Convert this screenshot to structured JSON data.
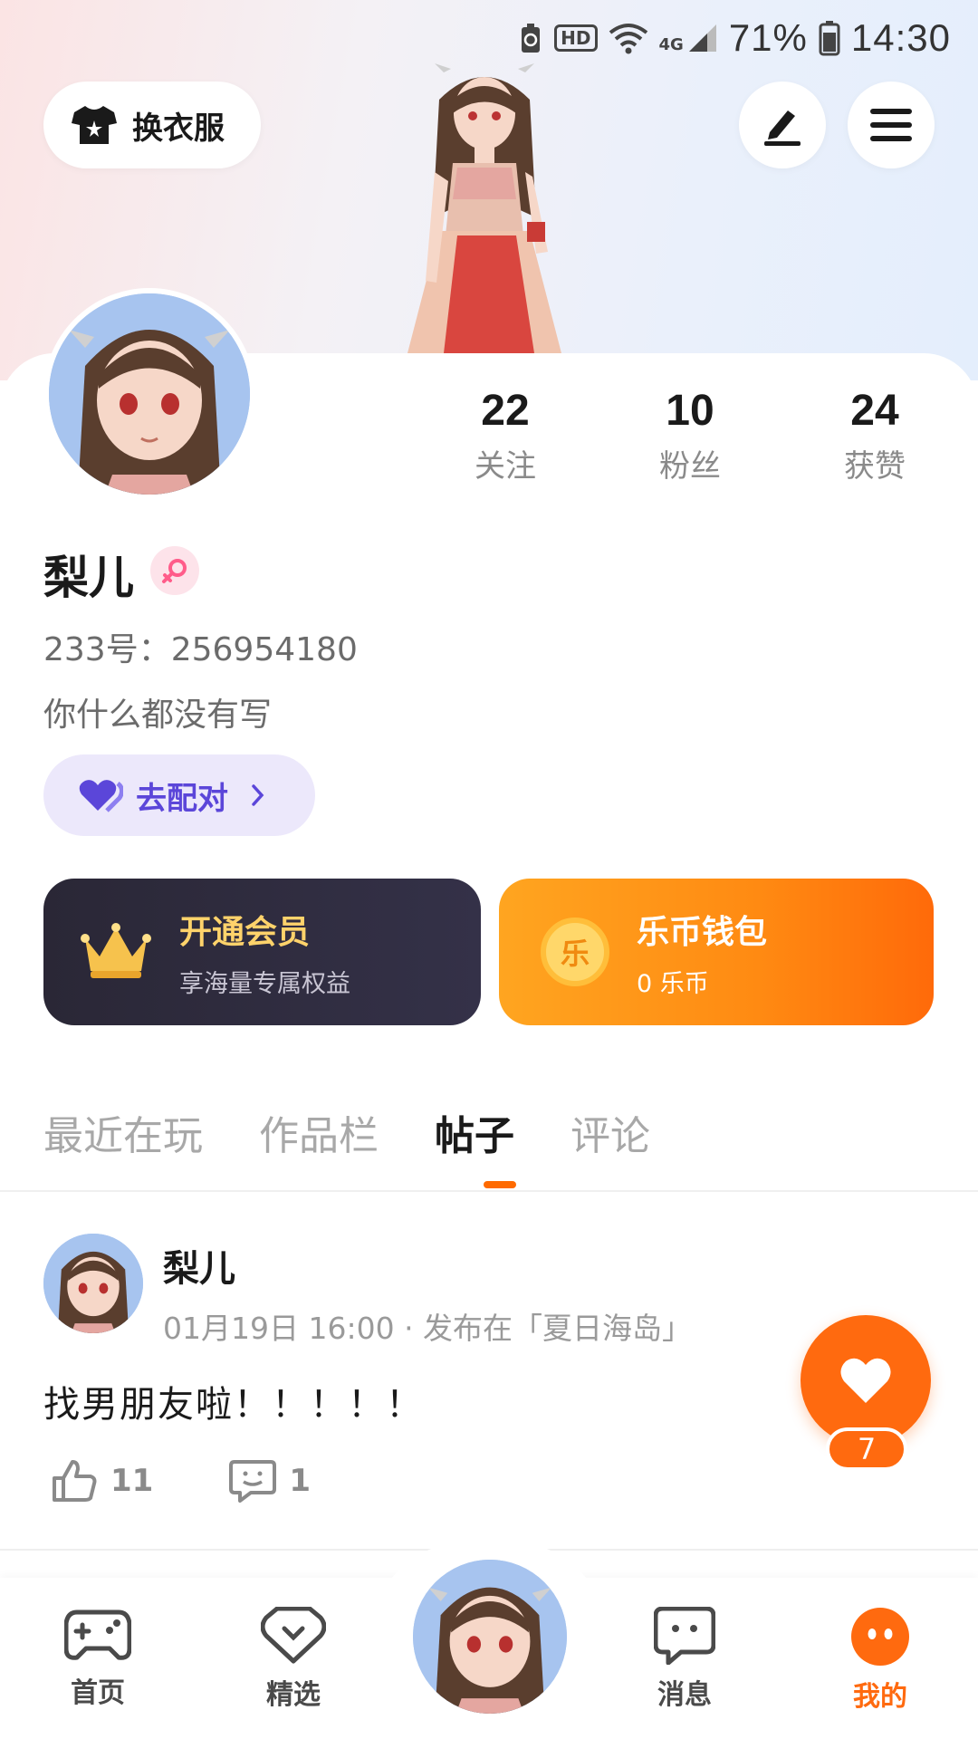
{
  "status_bar": {
    "network": "4G",
    "hd": "HD",
    "battery": "71%",
    "time": "14:30"
  },
  "header": {
    "wardrobe_label": "换衣服"
  },
  "stats": [
    {
      "value": "22",
      "label": "关注"
    },
    {
      "value": "10",
      "label": "粉丝"
    },
    {
      "value": "24",
      "label": "获赞"
    }
  ],
  "profile": {
    "name": "梨儿",
    "id_text": "233号：256954180",
    "bio": "你什么都没有写",
    "match_label": "去配对"
  },
  "vip": {
    "title": "开通会员",
    "subtitle": "享海量专属权益"
  },
  "wallet": {
    "title": "乐币钱包",
    "subtitle": "0 乐币",
    "coin_char": "乐"
  },
  "tabs": [
    {
      "label": "最近在玩",
      "active": false
    },
    {
      "label": "作品栏",
      "active": false
    },
    {
      "label": "帖子",
      "active": true
    },
    {
      "label": "评论",
      "active": false
    }
  ],
  "post": {
    "author": "梨儿",
    "meta": "01月19日 16:00 · 发布在「夏日海岛」",
    "text": "找男朋友啦！！！！！",
    "likes": "11",
    "comments": "1"
  },
  "fab": {
    "count": "7"
  },
  "bottom_nav": [
    {
      "label": "首页",
      "icon": "gamepad-icon"
    },
    {
      "label": "精选",
      "icon": "heart-chat-icon"
    },
    {
      "label": "消息",
      "icon": "message-icon"
    },
    {
      "label": "我的",
      "icon": "me-icon",
      "active": true
    }
  ],
  "colors": {
    "accent": "#ff6a0f",
    "match": "#5b46d9",
    "vip_bg": "#2a2736",
    "vip_text": "#ffd36b"
  }
}
